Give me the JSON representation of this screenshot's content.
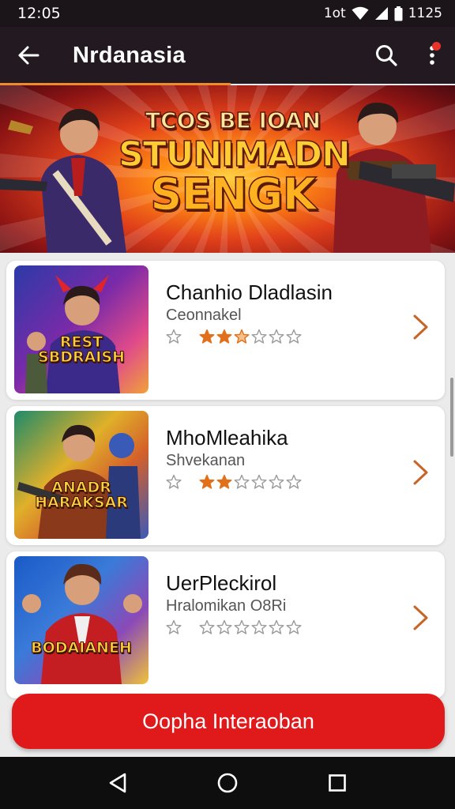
{
  "status_bar": {
    "time": "12:05",
    "indicator": "1ot",
    "battery_text": "1125"
  },
  "app_bar": {
    "title": "Nrdanasia"
  },
  "hero": {
    "line1": "TCOS BE IOAN",
    "line2": "STUNIMADN",
    "line3": "SENGK"
  },
  "games": [
    {
      "title": "Chanhio Dladlasin",
      "subtitle": "Ceonnakel",
      "rating": 2.5,
      "art_text": "REST SBDRAISH",
      "colors": [
        "#2b3aa8",
        "#e04a8a",
        "#f0a23a"
      ]
    },
    {
      "title": "MhoMleahika",
      "subtitle": "Shvekanan",
      "rating": 2.0,
      "art_text": "ANADR HARAKSAR",
      "colors": [
        "#1e8a6a",
        "#e0b02a",
        "#3a5ab8"
      ]
    },
    {
      "title": "UerPleckirol",
      "subtitle": "Hralomikan O8Ri",
      "rating": 0,
      "art_text": "BODAIANEH",
      "colors": [
        "#1a5ac8",
        "#d4262a",
        "#f0c23a"
      ]
    }
  ],
  "cta": {
    "label": "Oopha Interaoban"
  },
  "colors": {
    "accent": "#e0191b",
    "tab_indicator": "#f08a2a",
    "star_active": "#e2701a",
    "star_empty": "#9a9a9a"
  },
  "icons": {
    "back": "arrow-left-icon",
    "search": "search-icon",
    "menu": "more-vertical-icon",
    "chevron": "chevron-right-icon",
    "nav_back": "triangle-back-icon",
    "nav_home": "circle-home-icon",
    "nav_recents": "square-recents-icon"
  }
}
